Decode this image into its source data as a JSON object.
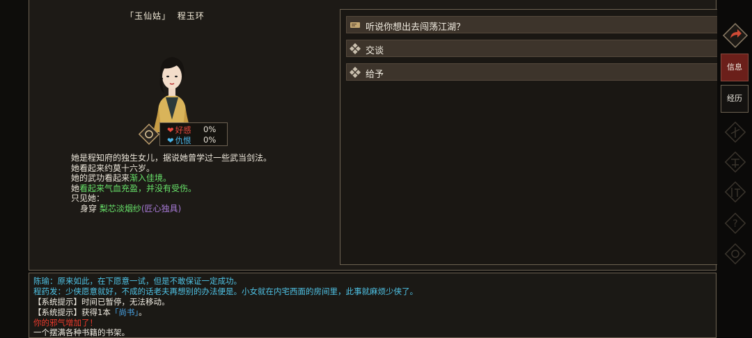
{
  "character": {
    "title": "「玉仙姑」  程玉环",
    "affection_label": "好感",
    "affection_value": "0%",
    "hatred_label": "仇恨",
    "hatred_value": "0%"
  },
  "description": {
    "line1": "她是程知府的独生女儿，据说她曾学过一些武当剑法。",
    "line2": "她看起来约莫十六岁。",
    "line3_prefix": "她的武功看起来",
    "line3_level": "渐入佳境。",
    "line4_prefix": "她",
    "line4_status": "看起来气血充盈，并没有受伤。",
    "line5": "只见她：",
    "wear_label": "身穿",
    "wear_item": "梨芯淡烟纱",
    "wear_quality": "(匠心独具)"
  },
  "options": [
    {
      "label": "听说你想出去闯荡江湖？",
      "icon": "scroll-icon"
    },
    {
      "label": "交谈",
      "icon": "diamond-icon"
    },
    {
      "label": "给予",
      "icon": "diamond-icon"
    }
  ],
  "log": {
    "line1": "陈瑜：原来如此，在下愿意一试，但是不敢保证一定成功。",
    "line2": "程药发：少侠愿意就好，不成的话老夫再想别的办法便是。小女就在内宅西面的房间里，此事就麻烦少侠了。",
    "line3": "【系统提示】时间已暂停，无法移动。",
    "line4_prefix": "【系统提示】获得1本",
    "line4_item": "「尚书」",
    "line4_suffix": "。",
    "line5": "你的邪气增加了！",
    "line6": "一个摆满各种书籍的书架。"
  },
  "sidebar": {
    "info_label": "信息",
    "history_label": "经历"
  },
  "colors": {
    "accent_red": "#6b1f1a",
    "green_text": "#68e36a",
    "cyan_text": "#4fc3e6",
    "red_text": "#ee3a2c"
  }
}
